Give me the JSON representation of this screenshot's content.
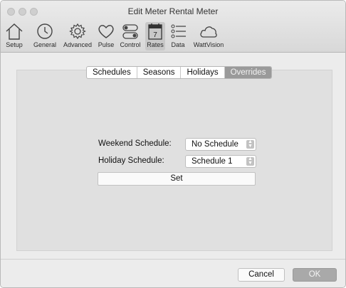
{
  "window": {
    "title": "Edit Meter Rental Meter"
  },
  "toolbar": {
    "items": [
      {
        "label": "Setup",
        "icon": "house-icon"
      },
      {
        "label": "General",
        "icon": "clock-icon"
      },
      {
        "label": "Advanced",
        "icon": "gear-icon"
      },
      {
        "label": "Pulse",
        "icon": "heart-icon"
      },
      {
        "label": "Control",
        "icon": "toggle-switch-icon"
      },
      {
        "label": "Rates",
        "icon": "calendar-icon",
        "badge": "7",
        "selected": true
      },
      {
        "label": "Data",
        "icon": "list-icon"
      },
      {
        "label": "WattVision",
        "icon": "cloud-icon"
      }
    ]
  },
  "tabs": {
    "items": [
      "Schedules",
      "Seasons",
      "Holidays",
      "Overrides"
    ],
    "selected": "Overrides"
  },
  "form": {
    "weekend_label": "Weekend Schedule:",
    "weekend_value": "No Schedule",
    "holiday_label": "Holiday Schedule:",
    "holiday_value": "Schedule 1",
    "set_label": "Set"
  },
  "footer": {
    "cancel_label": "Cancel",
    "ok_label": "OK"
  }
}
